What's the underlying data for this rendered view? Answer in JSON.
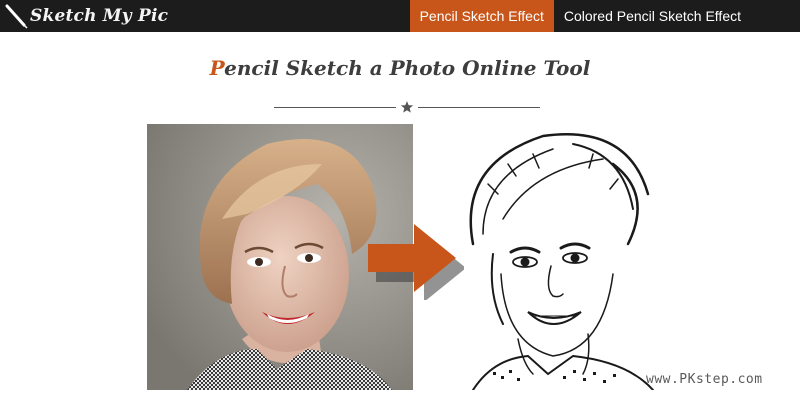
{
  "brand": {
    "name": "Sketch My Pic",
    "icon": "pencil-icon"
  },
  "nav": {
    "items": [
      {
        "label": "Pencil Sketch Effect",
        "active": true
      },
      {
        "label": "Colored Pencil Sketch Effect",
        "active": false
      }
    ]
  },
  "heading": {
    "first_letter": "P",
    "rest": "encil Sketch a Photo Online Tool"
  },
  "divider": {
    "icon": "star-icon"
  },
  "images": {
    "original": "photo-original",
    "result": "photo-sketch",
    "arrow_icon": "arrow-right-icon"
  },
  "watermark": "www.PKstep.com",
  "colors": {
    "topbar": "#1c1c1c",
    "accent": "#c8561a",
    "heading": "#3d3d3d"
  }
}
